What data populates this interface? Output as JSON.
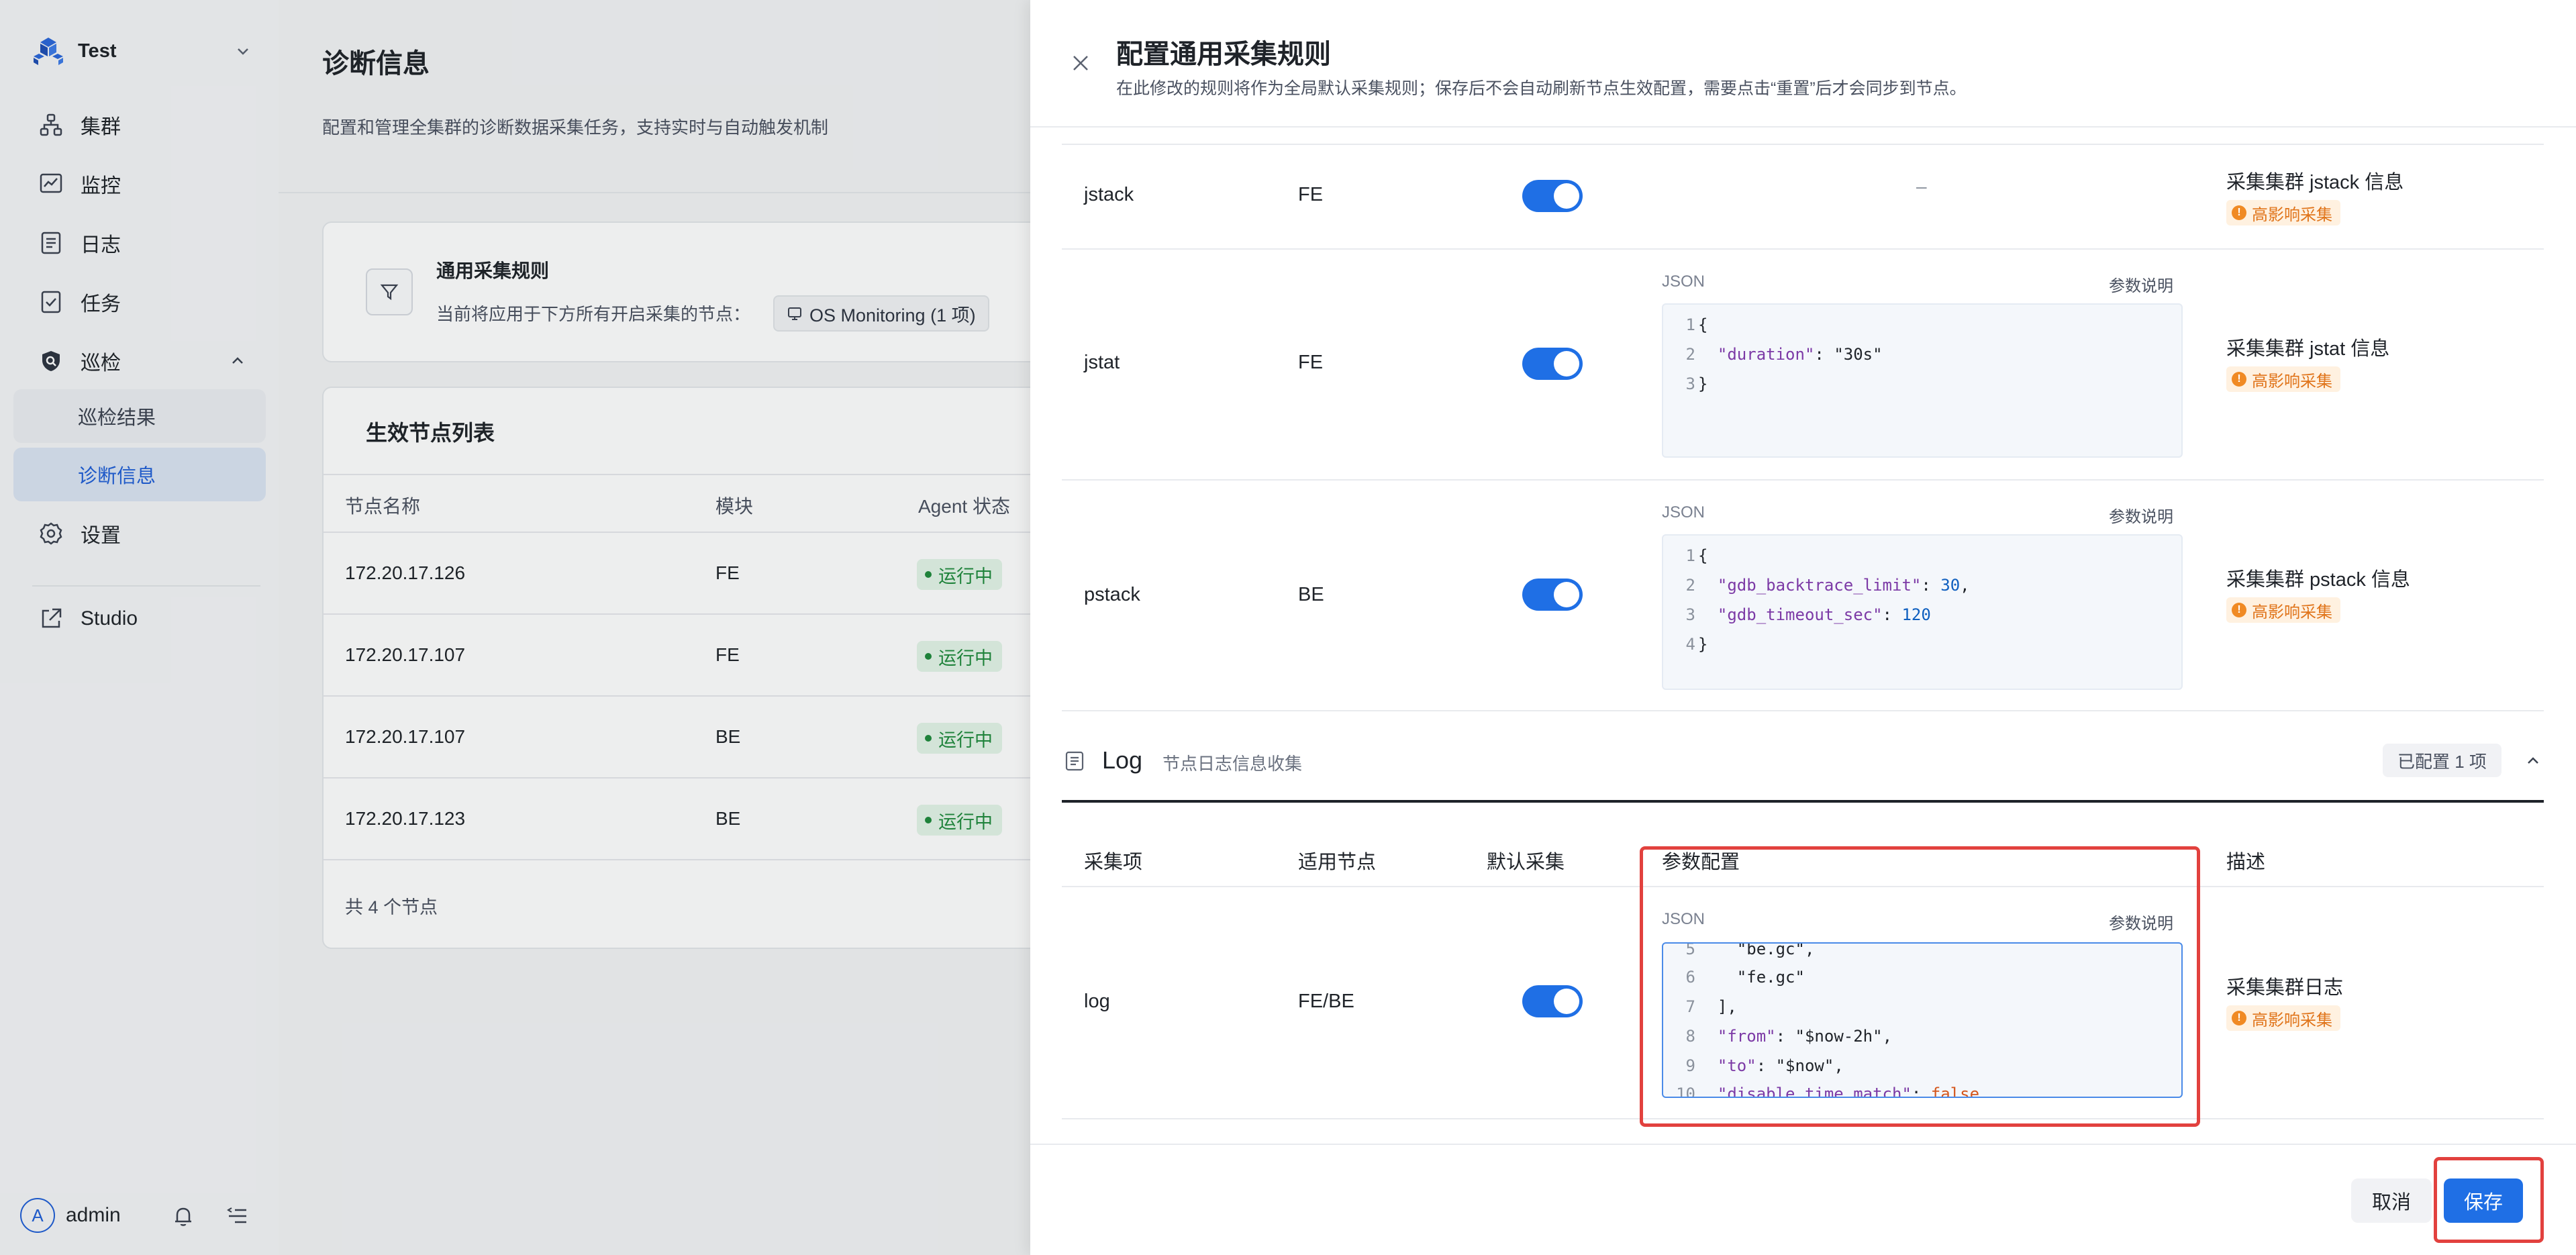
{
  "sidebar": {
    "workspace": "Test",
    "nav": [
      {
        "label": "集群",
        "icon": "cluster-icon"
      },
      {
        "label": "监控",
        "icon": "monitor-icon"
      },
      {
        "label": "日志",
        "icon": "log-icon"
      },
      {
        "label": "任务",
        "icon": "task-icon"
      },
      {
        "label": "巡检",
        "icon": "inspection-shield-icon"
      },
      {
        "label": "巡检结果"
      },
      {
        "label": "诊断信息"
      },
      {
        "label": "设置",
        "icon": "settings-gear-icon"
      },
      {
        "label": "Studio",
        "icon": "external-link-icon"
      }
    ],
    "user": {
      "initial": "A",
      "name": "admin"
    }
  },
  "main": {
    "title": "诊断信息",
    "description": "配置和管理全集群的诊断数据采集任务，支持实时与自动触发机制",
    "rule_card": {
      "title": "通用采集规则",
      "desc": "当前将应用于下方所有开启采集的节点：",
      "chip": "OS Monitoring (1 项)"
    },
    "nodes": {
      "title": "生效节点列表",
      "columns": [
        "节点名称",
        "模块",
        "Agent 状态"
      ],
      "rows": [
        {
          "name": "172.20.17.126",
          "module": "FE",
          "status": "运行中"
        },
        {
          "name": "172.20.17.107",
          "module": "FE",
          "status": "运行中"
        },
        {
          "name": "172.20.17.107",
          "module": "BE",
          "status": "运行中"
        },
        {
          "name": "172.20.17.123",
          "module": "BE",
          "status": "运行中"
        }
      ],
      "footer": "共 4 个节点"
    }
  },
  "drawer": {
    "title": "配置通用采集规则",
    "subtitle": "在此修改的规则将作为全局默认采集规则；保存后不会自动刷新节点生效配置，需要点击“重置”后才会同步到节点。",
    "json_label": "JSON",
    "param_help": "参数说明",
    "impact_tag": "高影响采集",
    "rows": [
      {
        "name": "jstack",
        "nodes": "FE",
        "config": "–",
        "desc": "采集集群 jstack 信息"
      },
      {
        "name": "jstat",
        "nodes": "FE",
        "desc": "采集集群 jstat 信息"
      },
      {
        "name": "pstack",
        "nodes": "BE",
        "desc": "采集集群 pstack 信息"
      }
    ],
    "log_section": {
      "title": "Log",
      "subtitle": "节点日志信息收集",
      "badge": "已配置 1 项",
      "headers": [
        "采集项",
        "适用节点",
        "默认采集",
        "参数配置",
        "描述"
      ],
      "row": {
        "name": "log",
        "nodes": "FE/BE",
        "desc": "采集集群日志"
      }
    },
    "buttons": {
      "cancel": "取消",
      "save": "保存"
    }
  }
}
